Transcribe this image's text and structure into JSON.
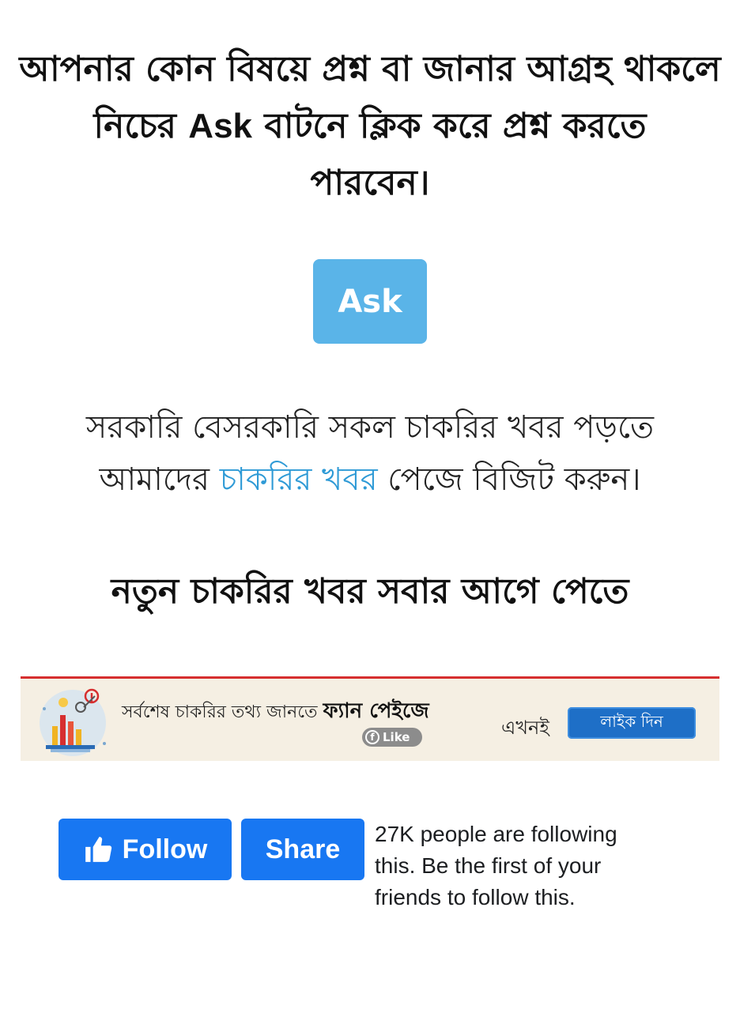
{
  "intro": {
    "line1": "আপনার কোন বিষয়ে প্রশ্ন বা জানার আগ্রহ থাকলে",
    "line2_before": "নিচের ",
    "line2_ask": "Ask",
    "line2_after": " বাটনে ক্লিক করে প্রশ্ন করতে",
    "line3": "পারবেন।"
  },
  "ask_button": {
    "label": "Ask",
    "color": "#5ab4e8"
  },
  "jobs": {
    "line1": "সরকারি বেসরকারি সকল চাকরির খবর পড়তে",
    "line2_before": "আমাদের ",
    "link_text": "চাকরির খবর",
    "line2_after": " পেজে বিজিট করুন।",
    "link_color": "#2e9ad6"
  },
  "headline": "নতুন চাকরির খবর সবার আগে পেতে",
  "banner": {
    "text_before": "সর্বশেষ চাকরির তথ্য জানতে ",
    "fan_page": "ফ্যান পেইজে",
    "fb_badge_icon": "f",
    "fb_badge": "Like",
    "now": "এখনই",
    "like_button": "লাইক দিন",
    "border_color": "#d62f2f",
    "bg_color": "#f5efe3"
  },
  "fb_widget": {
    "follow_label": "Follow",
    "share_label": "Share",
    "description": "27K people are following this. Be the first of your friends to follow this.",
    "brand_color": "#1877f2"
  }
}
